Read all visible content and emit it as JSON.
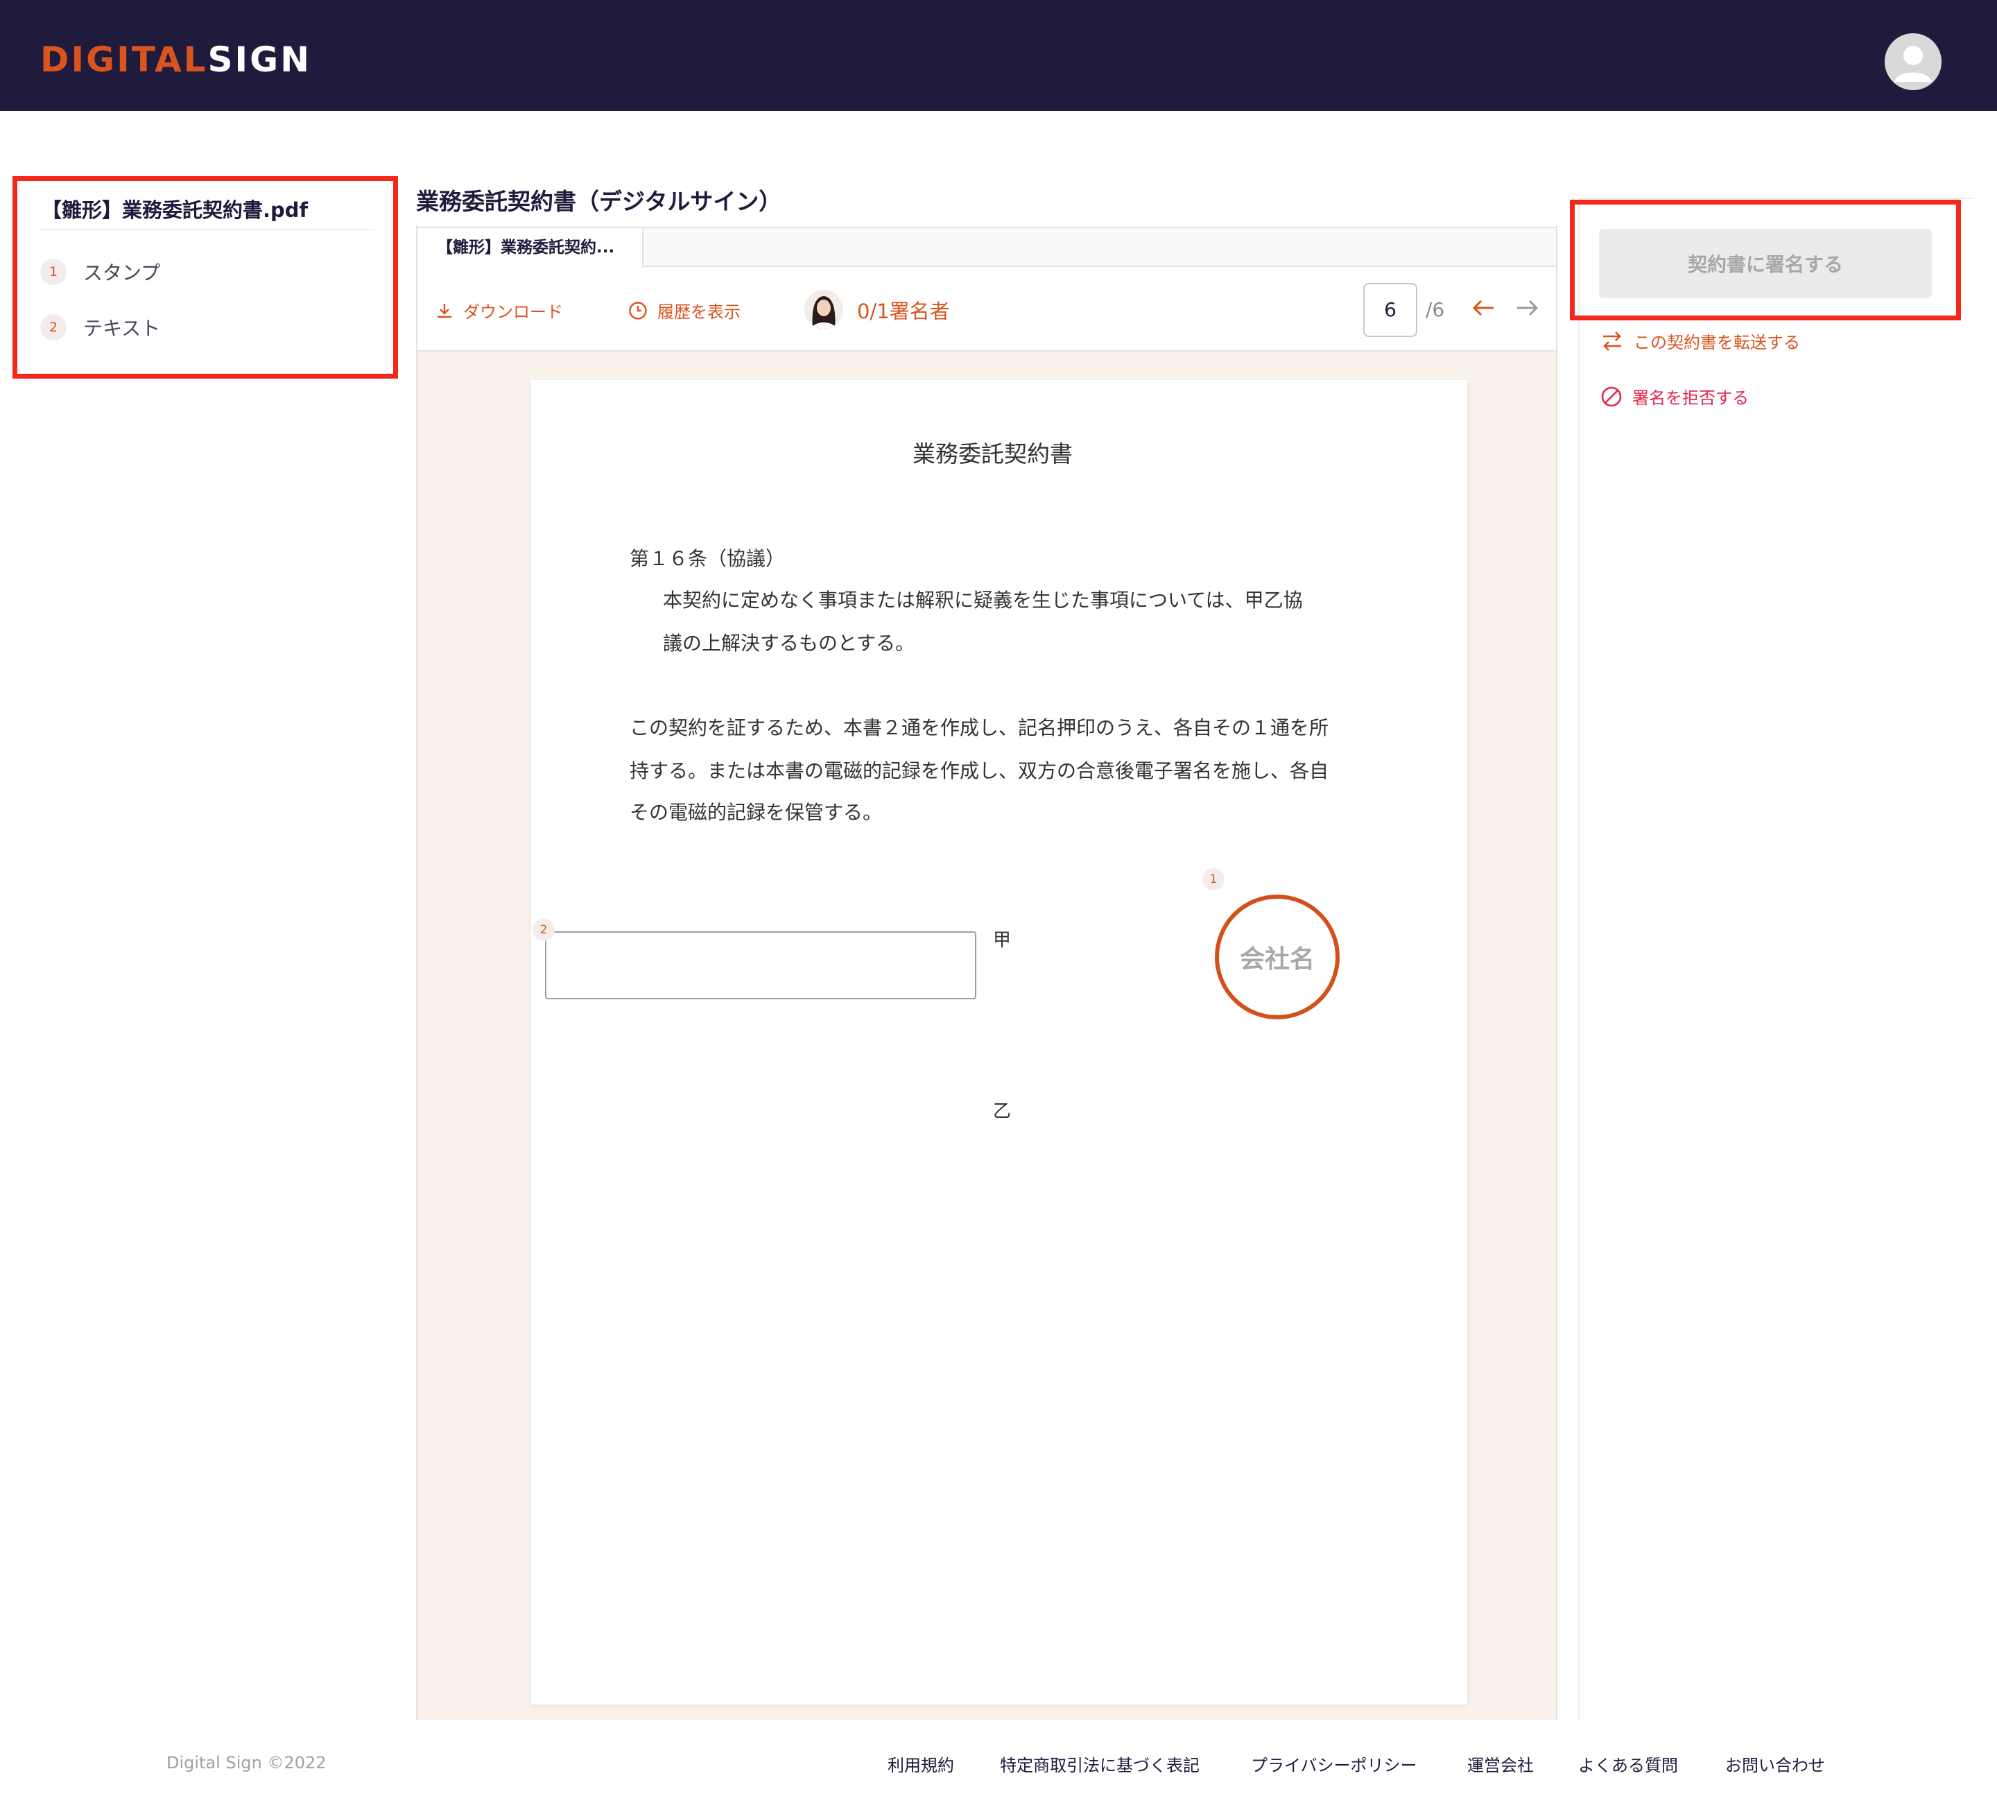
{
  "header": {
    "logo_part1": "DIGITAL",
    "logo_part2": "SIGN",
    "avatar_icon": "user-avatar-icon"
  },
  "sidebar": {
    "file_name": "【雛形】業務委託契約書.pdf",
    "fields": [
      {
        "number": "1",
        "label": "スタンプ"
      },
      {
        "number": "2",
        "label": "テキスト"
      }
    ]
  },
  "document": {
    "title": "業務委託契約書（デジタルサイン）",
    "tab_label": "【雛形】業務委託契約...",
    "toolbar": {
      "download_label": "ダウンロード",
      "history_label": "履歴を表示",
      "signer_count": "0/1署名者",
      "current_page": "6",
      "total_pages": "/6"
    },
    "page": {
      "heading": "業務委託契約書",
      "article": "第１６条（協議）",
      "para1_line1": "本契約に定めなく事項または解釈に疑義を生じた事項については、甲乙協",
      "para1_line2": "議の上解決するものとする。",
      "para2_line1": "この契約を証するため、本書２通を作成し、記名押印のうえ、各自その１通を所",
      "para2_line2": "持する。または本書の電磁的記録を作成し、双方の合意後電子署名を施し、各自",
      "para2_line3": "その電磁的記録を保管する。",
      "party_a": "甲",
      "party_b": "乙",
      "stamp_badge": "1",
      "text_field_badge": "2",
      "stamp_text": "会社名"
    }
  },
  "actions": {
    "sign_button": "契約書に署名する",
    "transfer_link": "この契約書を転送する",
    "reject_link": "署名を拒否する"
  },
  "footer": {
    "copyright": "Digital Sign ©2022",
    "links": [
      "利用規約",
      "特定商取引法に基づく表記",
      "プライバシーポリシー",
      "運営会社",
      "よくある質問",
      "お問い合わせ"
    ]
  },
  "colors": {
    "header_bg": "#1e1b3c",
    "accent": "#d9541e",
    "highlight_box": "#f3271a",
    "reject": "#e0284f",
    "document_bg": "#f9f2ea"
  }
}
